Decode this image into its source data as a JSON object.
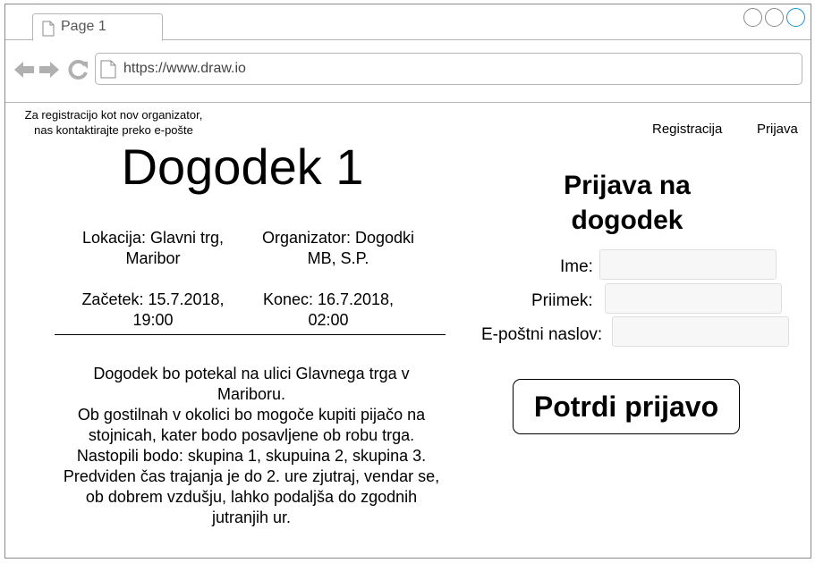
{
  "browser": {
    "tab_label": "Page 1",
    "url": "https://www.draw.io",
    "icons": {
      "back": "back-arrow-icon",
      "forward": "forward-arrow-icon",
      "reload": "reload-icon",
      "page": "document-icon"
    },
    "colors": {
      "chrome_gray": "#8a8a8a",
      "accent_blue": "#1a91d0"
    }
  },
  "header": {
    "organizer_note_line1": "Za registracijo kot nov organizator,",
    "organizer_note_line2": "nas kontaktirajte preko e-pošte",
    "registration_link": "Registracija",
    "login_link": "Prijava"
  },
  "event": {
    "title": "Dogodek 1",
    "location_line1": "Lokacija: Glavni trg,",
    "location_line2": "Maribor",
    "organizer_line1": "Organizator: Dogodki",
    "organizer_line2": "MB, S.P.",
    "start_line1": "Začetek: 15.7.2018,",
    "start_line2": "19:00",
    "end_line1": "Konec: 16.7.2018,",
    "end_line2": "02:00",
    "description": [
      "Dogodek bo potekal na ulici Glavnega trga v",
      "Mariboru.",
      "Ob gostilnah v okolici bo mogoče kupiti pijačo na",
      "stojnicah, kater bodo posavljene ob robu trga.",
      "Nastopili bodo: skupina 1, skupuina 2, skupina 3.",
      "Predviden čas trajanja je do 2. ure zjutraj, vendar se,",
      "ob dobrem vzdušju, lahko podaljša do zgodnih",
      "jutranjih ur."
    ]
  },
  "form": {
    "title_line1": "Prijava na",
    "title_line2": "dogodek",
    "name_label": "Ime:",
    "name_value": "",
    "surname_label": "Priimek:",
    "surname_value": "",
    "email_label": "E-poštni naslov:",
    "email_value": "",
    "submit_label": "Potrdi prijavo"
  }
}
